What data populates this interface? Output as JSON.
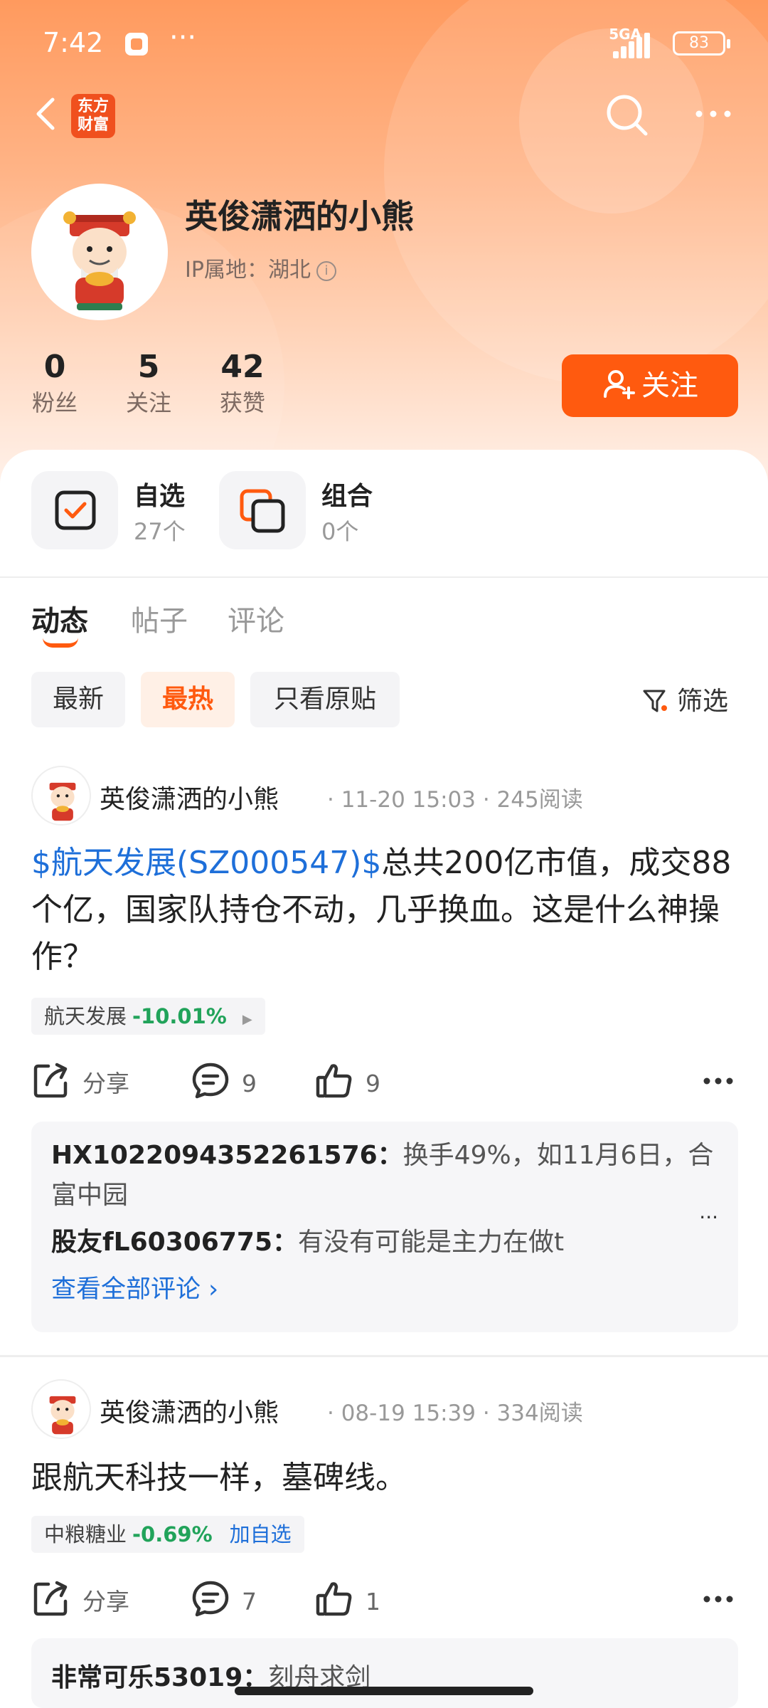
{
  "status_bar": {
    "time": "7:42",
    "dots": "···",
    "network": "5GA",
    "battery": "83"
  },
  "header": {
    "logo_text": "东方财富"
  },
  "profile": {
    "name": "英俊潇洒的小熊",
    "ip_location": "IP属地：湖北",
    "stats": [
      {
        "value": "0",
        "label": "粉丝"
      },
      {
        "value": "5",
        "label": "关注"
      },
      {
        "value": "42",
        "label": "获赞"
      }
    ],
    "follow_label": "关注"
  },
  "quick_links": [
    {
      "title": "自选",
      "sub": "27个"
    },
    {
      "title": "组合",
      "sub": "0个"
    }
  ],
  "tabs": [
    "动态",
    "帖子",
    "评论"
  ],
  "filters": {
    "chips": [
      "最新",
      "最热",
      "只看原贴"
    ],
    "filter_label": "筛选"
  },
  "posts": [
    {
      "author": "英俊潇洒的小熊",
      "meta": "· 11-20 15:03 · 245阅读",
      "stock_link": "$航天发展(SZ000547)$",
      "text": "总共200亿市值，成交88个亿，国家队持仓不动，几乎换血。这是什么神操作？",
      "tag": {
        "name": "航天发展",
        "change": "-10.01%"
      },
      "share_label": "分享",
      "comment_count": "9",
      "like_count": "9",
      "comments": [
        {
          "user": "HX1022094352261576：",
          "text": "换手49%，如11月6日，合富中园"
        },
        {
          "user": "股友fL60306775：",
          "text": "有没有可能是主力在做t"
        }
      ],
      "view_all": "查看全部评论 ›"
    },
    {
      "author": "英俊潇洒的小熊",
      "meta": "· 08-19 15:39 · 334阅读",
      "text": "跟航天科技一样，墓碑线。",
      "tag": {
        "name": "中粮糖业",
        "change": "-0.69%",
        "add": "加自选"
      },
      "share_label": "分享",
      "comment_count": "7",
      "like_count": "1",
      "comments": [
        {
          "user": "非常可乐53019：",
          "text": "刻舟求剑"
        }
      ]
    }
  ]
}
